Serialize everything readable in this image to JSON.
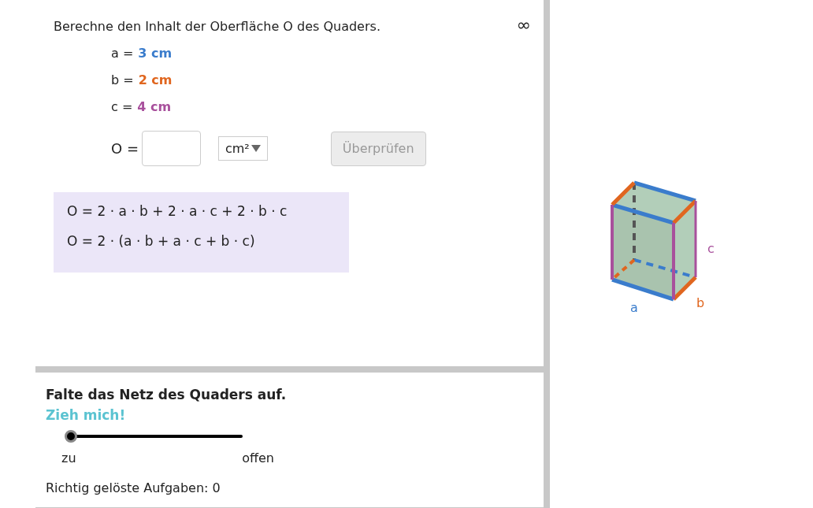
{
  "task": {
    "text": "Berechne den Inhalt der Oberfläche O des Quaders.",
    "corner_symbol": "∞"
  },
  "givens": [
    {
      "label": "a =",
      "value": "3 cm",
      "color": "#3a7ccc"
    },
    {
      "label": "b =",
      "value": "2 cm",
      "color": "#e0661f"
    },
    {
      "label": "c =",
      "value": "4 cm",
      "color": "#a8509c"
    }
  ],
  "answer": {
    "label": "O =",
    "unit": "cm²",
    "check_button": {
      "label": "Überprüfen",
      "disabled": true
    }
  },
  "formulas": [
    "O = 2 · a · b + 2 · a · c + 2 · b · c",
    "O = 2 · (a · b + a · c + b · c)"
  ],
  "figure": {
    "labels": [
      "a",
      "b",
      "c"
    ]
  },
  "net": {
    "title": "Falte das Netz des Quaders auf.",
    "hint": "Zieh mich!",
    "slider": {
      "level": 0,
      "min_label": "zu",
      "max_label": "offen"
    }
  },
  "score": "Richtig gelöste Aufgaben: 0"
}
